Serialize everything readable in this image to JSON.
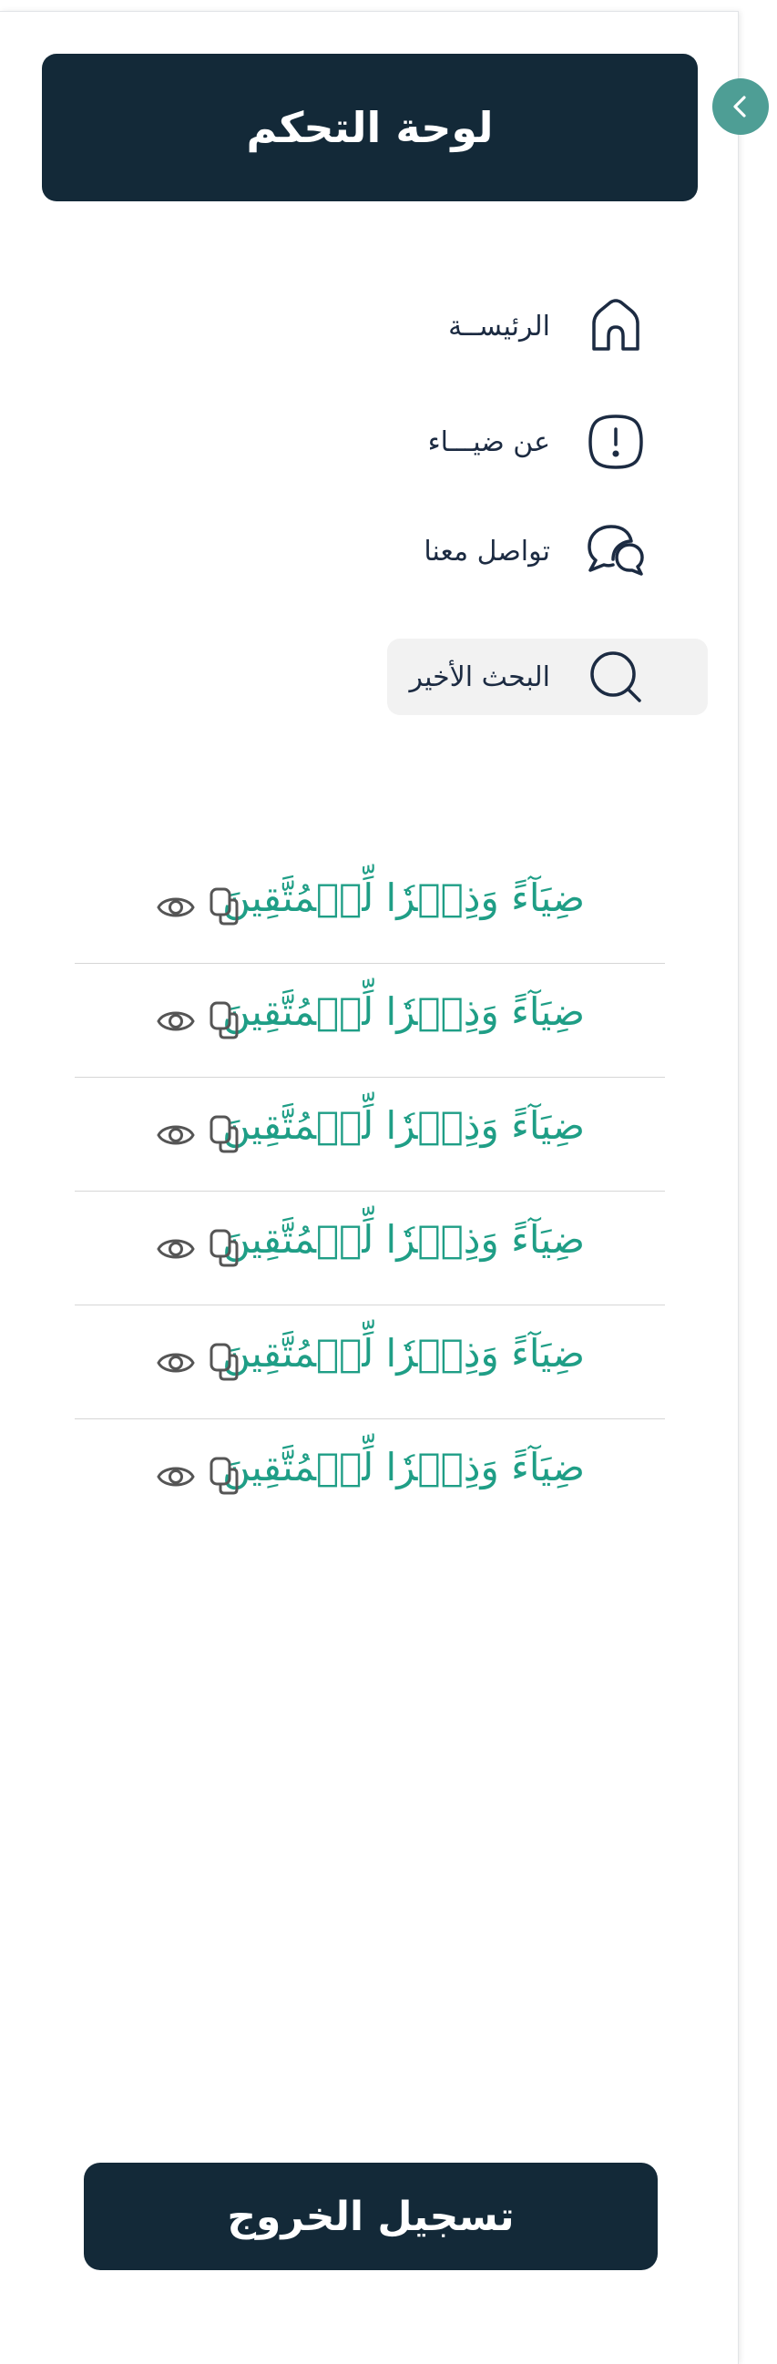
{
  "header": {
    "title": "لوحة التحكم"
  },
  "collapse": {
    "icon": "chevron-left-icon"
  },
  "nav": [
    {
      "label": "الرئيســة",
      "icon": "home-icon",
      "active": false
    },
    {
      "label": "عن ضيـــاء",
      "icon": "alert-icon",
      "active": false
    },
    {
      "label": "تواصل معنا",
      "icon": "chat-icon",
      "active": false
    },
    {
      "label": "البحث الأخير",
      "icon": "search-icon",
      "active": true
    }
  ],
  "recent_searches": [
    {
      "text": "ضِيَآءً وَذِكۡرٗا لِّلۡمُتَّقِينَ"
    },
    {
      "text": "ضِيَآءً وَذِكۡرٗا لِّلۡمُتَّقِينَ"
    },
    {
      "text": "ضِيَآءً وَذِكۡرٗا لِّلۡمُتَّقِينَ"
    },
    {
      "text": "ضِيَآءً وَذِكۡرٗا لِّلۡمُتَّقِينَ"
    },
    {
      "text": "ضِيَآءً وَذِكۡرٗا لِّلۡمُتَّقِينَ"
    },
    {
      "text": "ضِيَآءً وَذِكۡرٗا لِّلۡمُتَّقِينَ"
    }
  ],
  "logout": {
    "label": "تسجيل الخروج"
  },
  "colors": {
    "primary": "#132938",
    "accent": "#4e9e95",
    "verse": "#1f9e86",
    "active_bg": "#f2f2f2"
  }
}
